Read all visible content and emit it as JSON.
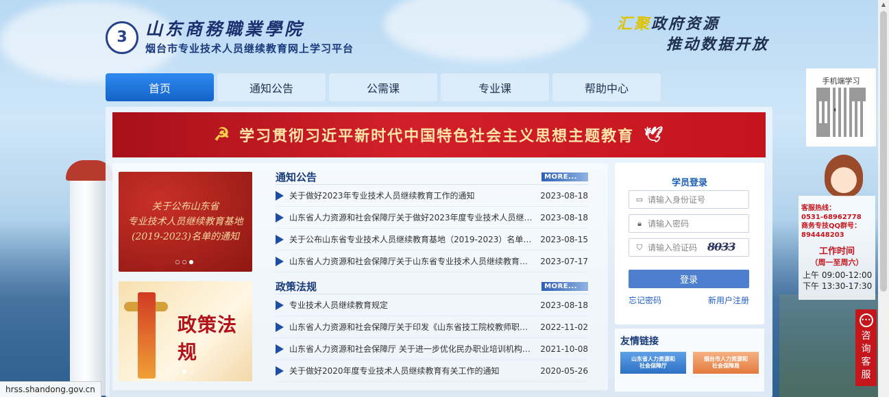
{
  "logo": {
    "mark": "3",
    "title": "山东商務職業學院",
    "subtitle": "烟台市专业技术人员继续教育网上学习平台"
  },
  "slogan": {
    "hl": "汇聚",
    "line1_rest": "政府资源",
    "line2": "推动数据开放"
  },
  "nav": [
    "首页",
    "通知公告",
    "公需课",
    "专业课",
    "帮助中心"
  ],
  "banner": {
    "emblem": "☭",
    "text": "学习贯彻习近平新时代中国特色社会主义思想主题教育",
    "dove": "🕊"
  },
  "notice_image": {
    "lines": [
      "关于公布山东省",
      "专业技术人员继续教育基地",
      "(2019-2023)名单的通知"
    ],
    "dots": "○○●"
  },
  "policy_image": {
    "text": "政策法规",
    "dots": "○●○"
  },
  "notices": {
    "title": "通知公告",
    "more": "MORE...",
    "items": [
      {
        "title": "关于做好2023年专业技术人员继续教育工作的通知",
        "date": "2023-08-18"
      },
      {
        "title": "山东省人力资源和社会保障厅关于做好2023年度专业技术人员继续教...",
        "date": "2023-08-18"
      },
      {
        "title": "关于公布山东省专业技术人员继续教育基地（2019-2023）名单的通知",
        "date": "2023-08-15"
      },
      {
        "title": "山东省人力资源和社会保障厅关于山东省专业技术人员继续教育公共服...",
        "date": "2023-07-17"
      }
    ]
  },
  "policies": {
    "title": "政策法规",
    "more": "MORE...",
    "items": [
      {
        "title": "专业技术人员继续教育规定",
        "date": "2023-08-18"
      },
      {
        "title": "山东省人力资源和社会保障厅关于印发《山东省技工院校教师职称评价...",
        "date": "2022-11-02"
      },
      {
        "title": "山东省人力资源和社会保障厅 关于进一步优化民办职业培训机构审批服...",
        "date": "2021-10-08"
      },
      {
        "title": "关于做好2020年度专业技术人员继续教育有关工作的通知",
        "date": "2020-05-26"
      }
    ]
  },
  "login": {
    "title": "学员登录",
    "id_placeholder": "请输入身份证号",
    "password_placeholder": "请输入密码",
    "captcha_placeholder": "请输入验证码",
    "captcha_text": "8033",
    "button": "登录",
    "forgot": "忘记密码",
    "register": "新用户注册"
  },
  "friends": {
    "title": "友情链接",
    "links": [
      [
        "山东省人力资源和",
        "社会保障厅"
      ],
      [
        "烟台市人力资源和",
        "社会保障局"
      ]
    ]
  },
  "qr": {
    "label": "手机端学习"
  },
  "service": {
    "hotline": "客服热线：",
    "hotline_num": "0531-68962778",
    "qq_label": "商务专技QQ群号：",
    "qq_num": "894448203",
    "work_title": "工作时间",
    "work_days": "（周一至周六）",
    "am": "上午 09:00-12:00",
    "pm": "下午 13:30-17:30"
  },
  "consult": [
    "咨",
    "询",
    "客",
    "服"
  ],
  "status_url": "hrss.shandong.gov.cn",
  "colors": {
    "nav_active": "#1463c8",
    "banner_red": "#c5141e",
    "login_button": "#4d7fce",
    "consult_red": "#c5161c"
  }
}
